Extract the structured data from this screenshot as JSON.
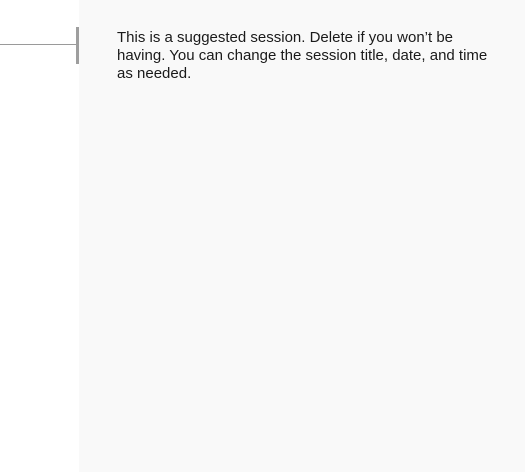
{
  "session": {
    "note": "This is a suggested session. Delete if you won’t be having. You can change the session title, date, and time as needed."
  }
}
